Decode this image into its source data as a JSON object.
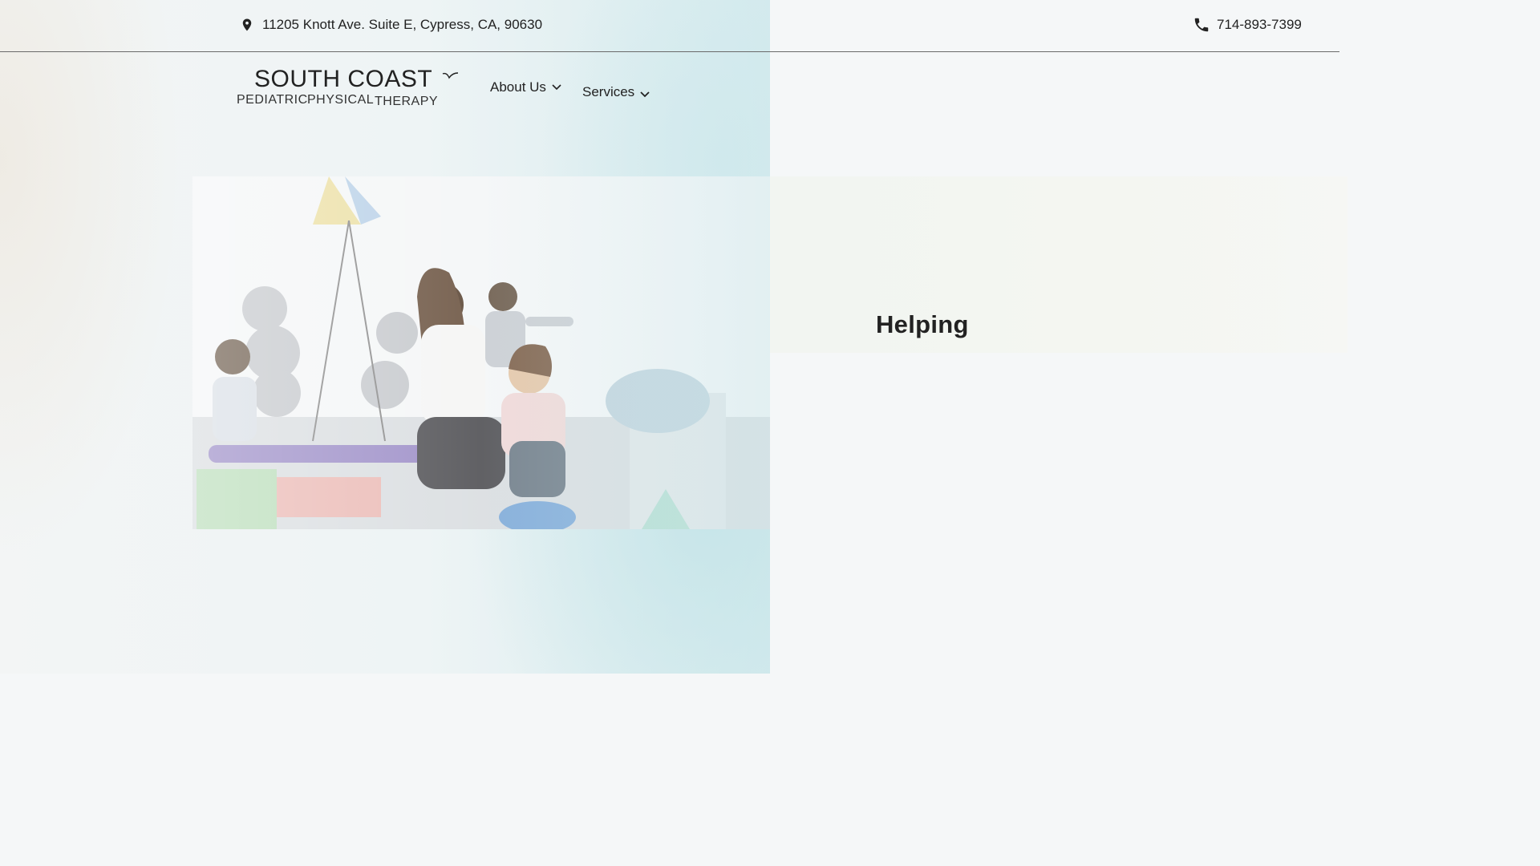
{
  "topbar": {
    "address": "11205 Knott Ave. Suite E, Cypress, CA, 90630",
    "phone": "714-893-7399",
    "address_icon": "map-pin-icon",
    "phone_icon": "phone-icon"
  },
  "logo": {
    "title": "SOUTH COAST",
    "line1": "PEDIATRIC",
    "line2": "PHYSICAL",
    "line3": "THERAPY",
    "mark_icon": "bird-icon"
  },
  "nav": {
    "items": [
      {
        "label": "About Us",
        "icon": "chevron-down-icon"
      },
      {
        "label": "Services",
        "icon": "chevron-down-icon"
      }
    ]
  },
  "hero": {
    "headline": "Helping"
  },
  "colors": {
    "text": "#1f1f1f",
    "background": "#f5f7f8",
    "accent_teal": "#cfe8ec"
  }
}
